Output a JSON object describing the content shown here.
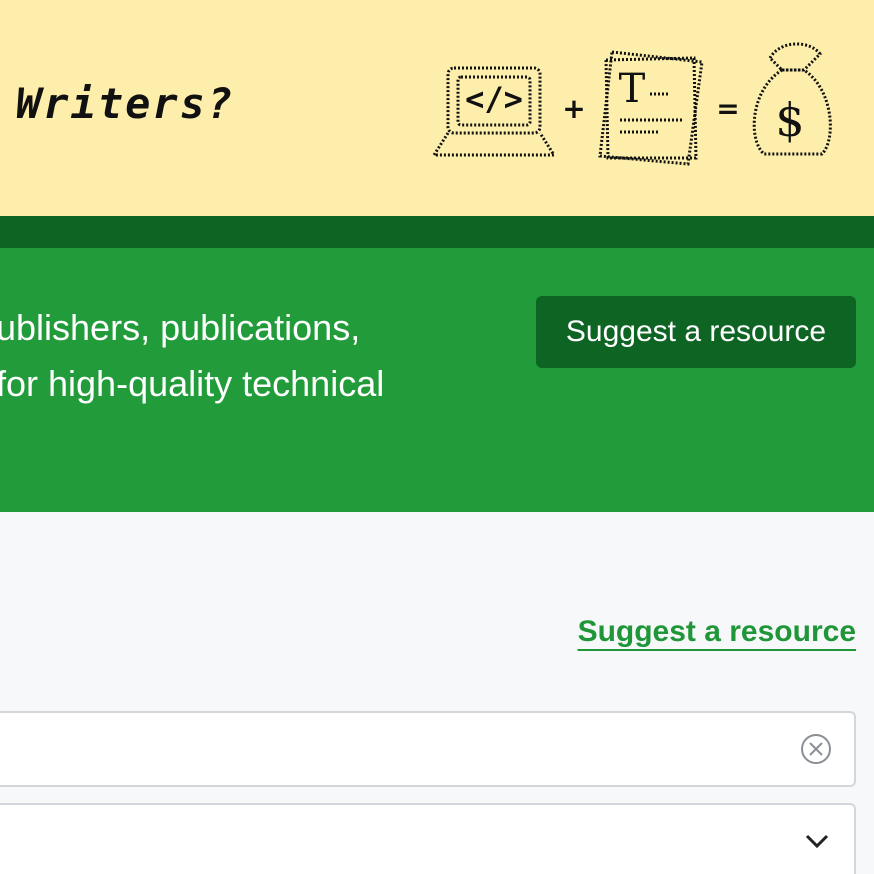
{
  "hero": {
    "title": "Writers?",
    "illustration": {
      "laptop_code": "</>",
      "plus": "+",
      "document_letter": "T",
      "equals": "=",
      "money_symbol": "$"
    }
  },
  "banner": {
    "line1": "ublishers, publications,",
    "line2": " for high-quality technical",
    "button_label": "Suggest a resource"
  },
  "main": {
    "suggest_link": "Suggest a resource",
    "search": {
      "value": "",
      "placeholder": ""
    },
    "select": {
      "value": ""
    }
  },
  "colors": {
    "hero_bg": "#fdefab",
    "stripe": "#0e6523",
    "banner_bg": "#229c3b",
    "button_bg": "#0e6523",
    "link": "#1f9637",
    "page_bg": "#f7f8fa"
  }
}
